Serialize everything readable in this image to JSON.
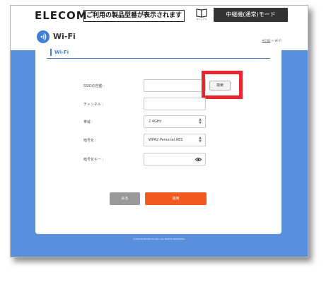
{
  "header": {
    "logo": "ELECOM",
    "notice": "ご利用の製品型番が表示されます",
    "manual_label": "マニュアル",
    "mode_button": "中継機(通常)モード"
  },
  "page": {
    "title": "Wi-Fi",
    "breadcrumb_home": "HOME",
    "breadcrumb_rest": " > Wi-Fi",
    "section_title": "Wi-Fi"
  },
  "form": {
    "ssid_label": "SSIDの自動 :",
    "ssid_value": "",
    "search_button": "検索",
    "channel_label": "チャンネル :",
    "channel_value": "",
    "band_label": "帯域 :",
    "band_value": "2.4GHz",
    "encryption_label": "暗号化 :",
    "encryption_value": "WPA2 Personal AES",
    "key_label": "暗号化キー :",
    "key_value": ""
  },
  "actions": {
    "back_button": "戻る",
    "apply_button": "適用"
  },
  "footer": {
    "copyright": "©2020 ELECOM CO.,LTD. ALL RIGHTS RESERVED."
  },
  "colors": {
    "accent": "#3f7fd8",
    "band": "#5a8fde",
    "apply": "#f05a1e",
    "highlight": "#e8262d"
  },
  "icons": {
    "manual": "book-icon",
    "wifi": "wifi-icon",
    "eye": "eye-icon",
    "select_arrows": "updown-arrows-icon"
  }
}
